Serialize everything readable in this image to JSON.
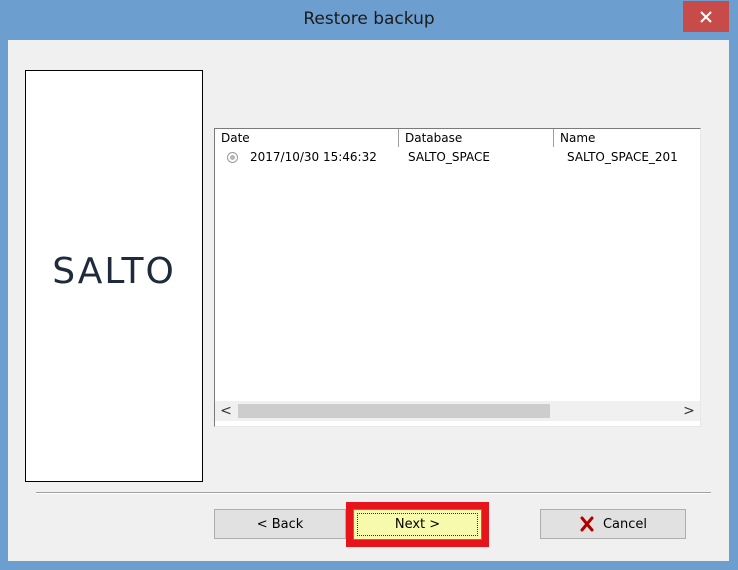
{
  "window": {
    "title": "Restore backup",
    "close_glyph": "✕"
  },
  "logo": {
    "text": "SALTO"
  },
  "backup_list": {
    "columns": [
      "Date",
      "Database",
      "Name"
    ],
    "rows": [
      {
        "date": "2017/10/30 15:46:32",
        "database": "SALTO_SPACE",
        "name": "SALTO_SPACE_201"
      }
    ],
    "scroll_left": "<",
    "scroll_right": ">"
  },
  "buttons": {
    "back": "< Back",
    "next": "Next >",
    "cancel": "Cancel"
  },
  "icons": {
    "close": "close-icon",
    "cancel": "x-cross-icon"
  },
  "colors": {
    "titlebar": "#6d9ed0",
    "close": "#c74b48",
    "highlight": "#e8141c",
    "next_default": "#f7f9ab"
  }
}
